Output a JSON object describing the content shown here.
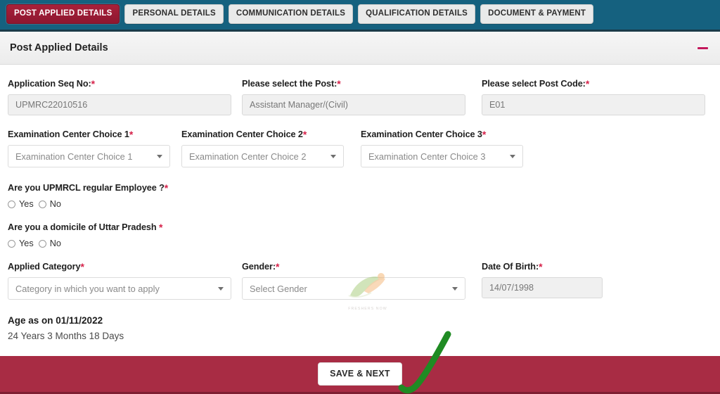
{
  "tabs": [
    {
      "label": "POST APPLIED DETAILS",
      "active": true
    },
    {
      "label": "PERSONAL DETAILS",
      "active": false
    },
    {
      "label": "COMMUNICATION DETAILS",
      "active": false
    },
    {
      "label": "QUALIFICATION DETAILS",
      "active": false
    },
    {
      "label": "DOCUMENT & PAYMENT",
      "active": false
    }
  ],
  "panel": {
    "title": "Post Applied Details",
    "collapse_icon": "minus-icon"
  },
  "fields": {
    "application_seq_no": {
      "label": "Application Seq No:",
      "required": "*",
      "value": "UPMRC22010516"
    },
    "post": {
      "label": "Please select the Post:",
      "required": "*",
      "value": "Assistant Manager/(Civil)"
    },
    "post_code": {
      "label": "Please select Post Code:",
      "required": "*",
      "value": "E01"
    },
    "exam_center_1": {
      "label": "Examination Center Choice 1",
      "required": "*",
      "placeholder": "Examination Center Choice 1"
    },
    "exam_center_2": {
      "label": "Examination Center Choice 2",
      "required": "*",
      "placeholder": "Examination Center Choice 2"
    },
    "exam_center_3": {
      "label": "Examination Center Choice 3",
      "required": "*",
      "placeholder": "Examination Center Choice 3"
    },
    "upmrcl_employee": {
      "label": "Are you UPMRCL regular Employee ?",
      "required": "*",
      "yes": "Yes",
      "no": "No"
    },
    "domicile_up": {
      "label": "Are you a domicile of Uttar Pradesh",
      "required": "*",
      "yes": "Yes",
      "no": "No"
    },
    "applied_category": {
      "label": "Applied Category",
      "required": "*",
      "placeholder": "Category in which you want to apply"
    },
    "gender": {
      "label": "Gender:",
      "required": "*",
      "placeholder": "Select Gender"
    },
    "dob": {
      "label": "Date Of Birth:",
      "required": "*",
      "value": "14/07/1998"
    }
  },
  "age": {
    "heading": "Age as on 01/11/2022",
    "value": "24 Years 3 Months 18 Days"
  },
  "watermark": {
    "logo_text": "FRESHERS NOW",
    "url": "https://www.freshersnow.com/"
  },
  "footer": {
    "save_label": "SAVE & NEXT"
  },
  "colors": {
    "header_bar": "#15617f",
    "active_tab": "#9e1b34",
    "footer_bar": "#a82c44",
    "required_asterisk": "#d6224a",
    "collapse_icon": "#c2185b",
    "annotation_arrow": "#1f8b23"
  }
}
